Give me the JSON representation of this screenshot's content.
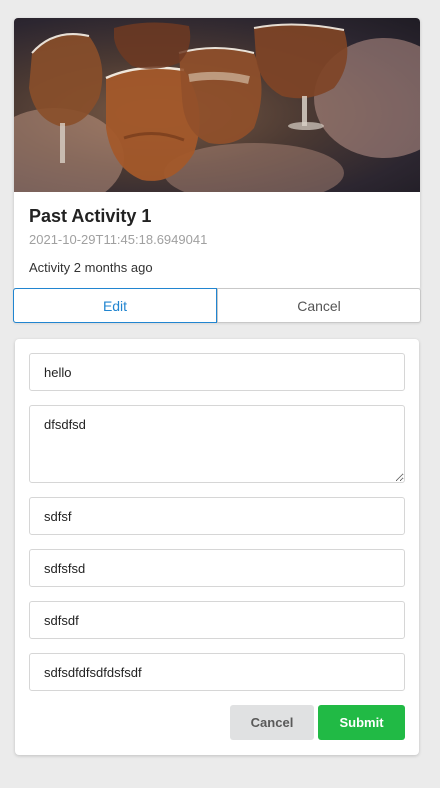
{
  "activity": {
    "title": "Past Activity 1",
    "timestamp": "2021-10-29T11:45:18.6949041",
    "description": "Activity 2 months ago",
    "image": "beer-glasses-toast-photo"
  },
  "toggle": {
    "edit_label": "Edit",
    "cancel_label": "Cancel"
  },
  "form": {
    "field1": "hello",
    "field2": "dfsdfsd",
    "field3": "sdfsf",
    "field4": "sdfsfsd",
    "field5": "sdfsdf",
    "field6": "sdfsdfdfsdfdsfsdf",
    "cancel_label": "Cancel",
    "submit_label": "Submit"
  },
  "colors": {
    "accent": "#2185d0",
    "submit": "#21ba45",
    "cancel_bg": "#e0e1e2"
  }
}
